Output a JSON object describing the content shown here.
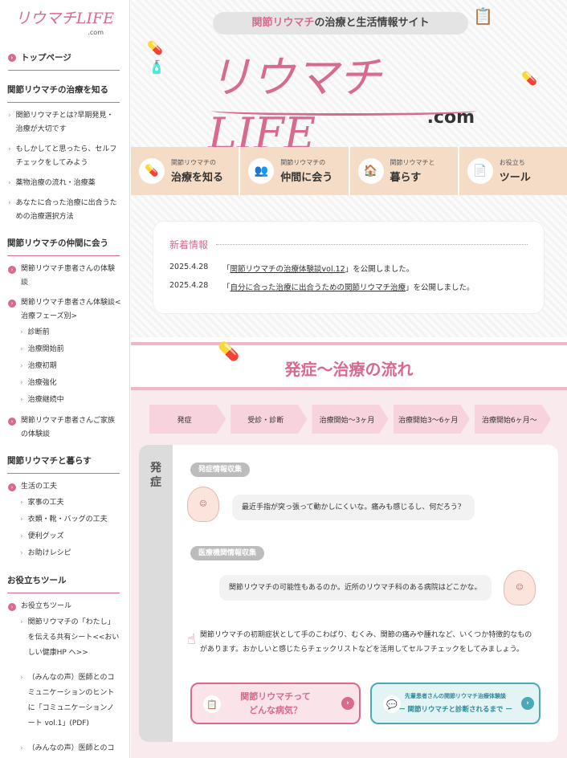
{
  "sidebar": {
    "logo": "リウマチLIFE",
    "logo_suffix": ".com",
    "top_link": "トップページ",
    "sections": [
      {
        "heading": "関節リウマチの治療を知る",
        "links": [
          "関節リウマチとは?早期発見・治療が大切です",
          "もしかしてと思ったら、セルフチェックをしてみよう",
          "薬物治療の流れ・治療薬",
          "あなたに合った治療に出合うための治療選択方法"
        ]
      },
      {
        "heading": "関節リウマチの仲間に会う",
        "circ_links": [
          "関節リウマチ患者さんの体験談",
          "関節リウマチ患者さん体験談<治療フェーズ別>"
        ],
        "sub_links": [
          "診断前",
          "治療開始前",
          "治療初期",
          "治療強化",
          "治療継続中"
        ],
        "circ_link_last": "関節リウマチ患者さんご家族の体験談"
      },
      {
        "heading": "関節リウマチと暮らす",
        "circ_link": "生活の工夫",
        "sub_links": [
          "家事の工夫",
          "衣類・靴・バッグの工夫",
          "便利グッズ",
          "お助けレシピ"
        ]
      },
      {
        "heading": "お役立ちツール",
        "circ_link": "お役立ちツール",
        "sub_links": [
          "関節リウマチの「わたし」を伝える共有シート<<おいしい健康HP へ>>",
          "（みんなの声）医師とのコミュニケーションのヒントに「コミュニケーションノート vol.1」(PDF)",
          "（みんなの声）医師とのコミュニケーションのヒント"
        ]
      }
    ]
  },
  "hero": {
    "tagline_pink": "関節リウマチ",
    "tagline_rest": "の治療と生活情報サイト",
    "logo": "リウマチLIFE",
    "logo_suffix": ".com"
  },
  "nav": [
    {
      "small": "関節リウマチの",
      "big": "治療を知る",
      "icon": "pills-icon"
    },
    {
      "small": "関節リウマチの",
      "big": "仲間に会う",
      "icon": "people-icon"
    },
    {
      "small": "関節リウマチと",
      "big": "暮らす",
      "icon": "house-icon"
    },
    {
      "small": "お役立ち",
      "big": "ツール",
      "icon": "document-icon"
    }
  ],
  "news": {
    "heading": "新着情報",
    "items": [
      {
        "date": "2025.4.28",
        "pre": "「",
        "link": "関節リウマチの治療体験談vol.12",
        "post": "」を公開しました。"
      },
      {
        "date": "2025.4.28",
        "pre": "「",
        "link": "自分に合った治療に出合うための関節リウマチ治療",
        "post": "」を公開しました。"
      }
    ]
  },
  "flow": {
    "title": "発症〜治療の流れ",
    "steps": [
      "発症",
      "受診・診断",
      "治療開始〜3ヶ月",
      "治療開始3〜6ヶ月",
      "治療開始6ヶ月〜"
    ],
    "phase_label": [
      "発",
      "症"
    ],
    "pill1": "発症情報収集",
    "bubble1": "最近手指が突っ張って動かしにくいな。痛みも感じるし、何だろう？",
    "pill2": "医療機関情報収集",
    "bubble2": "関節リウマチの可能性もあるのか。近所のリウマチ科のある病院はどこかな。",
    "note": "関節リウマチの初期症状として手のこわばり、むくみ、関節の痛みや腫れなど、いくつか特徴的なものがあります。おかしいと感じたらチェックリストなどを活用してセルフチェックをしてみましょう。",
    "button1": [
      "関節リウマチって",
      "どんな病気？"
    ],
    "button2_small": "先輩患者さんの関節リウマチ治療体験談",
    "button2_big": "ー 関節リウマチと診断されるまで ー"
  },
  "colors": {
    "accent": "#d86a8e",
    "teal": "#4aa8b8",
    "nav_bg": "#f5dcc6"
  }
}
